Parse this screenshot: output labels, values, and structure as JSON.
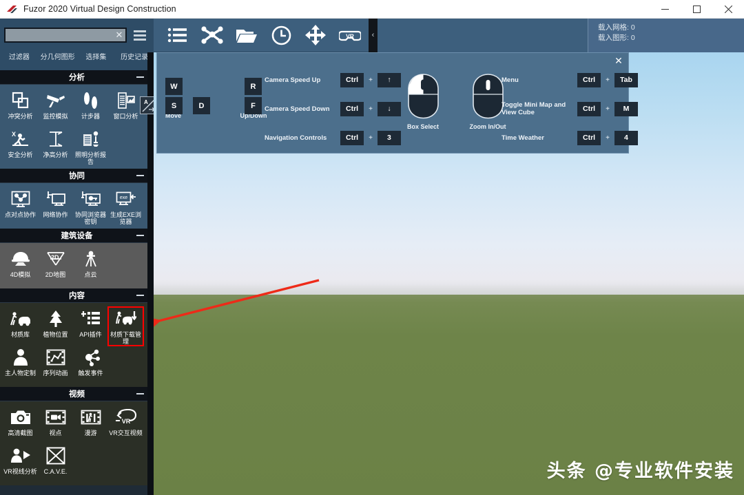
{
  "window": {
    "title": "Fuzor 2020 Virtual Design Construction",
    "logo_icon": "fuzor-logo-icon",
    "minimize_label": "—",
    "maximize_label": "☐",
    "close_label": "✕"
  },
  "toolbar": {
    "search": {
      "value": "",
      "placeholder": "",
      "clear_label": "✕",
      "icon": "search-input"
    },
    "hamburger_icon": "hamburger-menu-icon",
    "icons": [
      {
        "name": "list-view-icon",
        "title": "list"
      },
      {
        "name": "network-share-icon",
        "title": "network"
      },
      {
        "name": "open-folder-icon",
        "title": "open"
      },
      {
        "name": "clock-icon",
        "title": "time"
      },
      {
        "name": "move-arrows-icon",
        "title": "move"
      },
      {
        "name": "vr-headset-icon",
        "title": "vr"
      }
    ],
    "collapse_label": "‹",
    "status": {
      "loaded_mesh": "载入网格: 0",
      "loaded_graphics": "载入图形: 0"
    }
  },
  "sidebar": {
    "tabs": [
      {
        "label": "过滤器"
      },
      {
        "label": "分几何图形"
      },
      {
        "label": "选择集"
      },
      {
        "label": "历史记录"
      }
    ],
    "compass_label": "A",
    "sections": [
      {
        "title": "分析",
        "theme": "blue",
        "collapse_icon": "minus-icon",
        "items": [
          {
            "label": "冲突分析",
            "icon": "clash-detection-icon"
          },
          {
            "label": "监控模拟",
            "icon": "security-camera-icon"
          },
          {
            "label": "计步器",
            "icon": "footsteps-icon"
          },
          {
            "label": "窗口分析",
            "icon": "window-analysis-icon"
          },
          {
            "label": "安全分析",
            "icon": "safety-analysis-icon"
          },
          {
            "label": "净高分析",
            "icon": "clear-height-icon"
          },
          {
            "label": "照明分析报告",
            "icon": "lighting-report-icon"
          }
        ]
      },
      {
        "title": "协同",
        "theme": "blue",
        "collapse_icon": "minus-icon",
        "items": [
          {
            "label": "点对点协作",
            "icon": "peer-to-peer-icon"
          },
          {
            "label": "网络协作",
            "icon": "network-collab-icon"
          },
          {
            "label": "协同浏览器密钥",
            "icon": "browser-key-icon"
          },
          {
            "label": "生成EXE浏览器",
            "icon": "generate-exe-icon"
          }
        ]
      },
      {
        "title": "建筑设备",
        "theme": "gray",
        "collapse_icon": "minus-icon",
        "items": [
          {
            "label": "4D模拟",
            "icon": "hardhat-4d-icon"
          },
          {
            "label": "2D地图",
            "icon": "2d-map-icon"
          },
          {
            "label": "点云",
            "icon": "point-cloud-icon"
          }
        ]
      },
      {
        "title": "内容",
        "theme": "dark",
        "collapse_icon": "minus-icon",
        "items": [
          {
            "label": "材质库",
            "icon": "material-library-icon"
          },
          {
            "label": "植物位置",
            "icon": "tree-placement-icon"
          },
          {
            "label": "API插件",
            "icon": "api-plugin-icon"
          },
          {
            "label": "材质下载管理",
            "icon": "material-download-icon",
            "highlighted": true
          },
          {
            "label": "主人物定制",
            "icon": "avatar-custom-icon"
          },
          {
            "label": "序列动画",
            "icon": "sequence-animation-icon"
          },
          {
            "label": "触发事件",
            "icon": "trigger-event-icon"
          }
        ]
      },
      {
        "title": "视频",
        "theme": "dark",
        "collapse_icon": "minus-icon",
        "items": [
          {
            "label": "高清截图",
            "icon": "camera-icon"
          },
          {
            "label": "视点",
            "icon": "viewpoint-film-icon"
          },
          {
            "label": "漫游",
            "icon": "walkthrough-film-icon"
          },
          {
            "label": "VR交互视频",
            "icon": "vr-interactive-video-icon"
          },
          {
            "label": "VR视线分析",
            "icon": "vr-sightline-icon"
          },
          {
            "label": "C.A.V.E.",
            "icon": "cave-icon"
          }
        ]
      }
    ]
  },
  "shortcuts_overlay": {
    "close_label": "✕",
    "move_group": {
      "keys": [
        "W",
        "S",
        "D"
      ],
      "caption": "Move"
    },
    "updown_group": {
      "keys": [
        "R",
        "F"
      ],
      "caption": "Up/Down"
    },
    "rows_left": [
      {
        "label": "Camera Speed Up",
        "key1": "Ctrl",
        "plus": "+",
        "key2": "↑"
      },
      {
        "label": "Camera Speed Down",
        "key1": "Ctrl",
        "plus": "+",
        "key2": "↓"
      },
      {
        "label": "Navigation Controls",
        "key1": "Ctrl",
        "plus": "+",
        "key2": "3"
      }
    ],
    "mice": [
      {
        "caption": "Box Select",
        "icon": "mouse-left-button-icon"
      },
      {
        "caption": "Zoom In/Out",
        "icon": "mouse-wheel-icon"
      }
    ],
    "rows_right": [
      {
        "label": "Menu",
        "key1": "Ctrl",
        "plus": "+",
        "key2": "Tab"
      },
      {
        "label": "Toggle Mini Map and View Cube",
        "key1": "Ctrl",
        "plus": "+",
        "key2": "M"
      },
      {
        "label": "Time Weather",
        "key1": "Ctrl",
        "plus": "+",
        "key2": "4"
      }
    ]
  },
  "viewport": {
    "watermark": "头条 @专业软件安装",
    "annotation_arrow": "red-pointer-arrow",
    "sky_color_top": "#a9d5ef",
    "sky_color_horizon": "#e6edf6",
    "ground_color": "#6b8146",
    "highlight_color": "#ff0000"
  }
}
